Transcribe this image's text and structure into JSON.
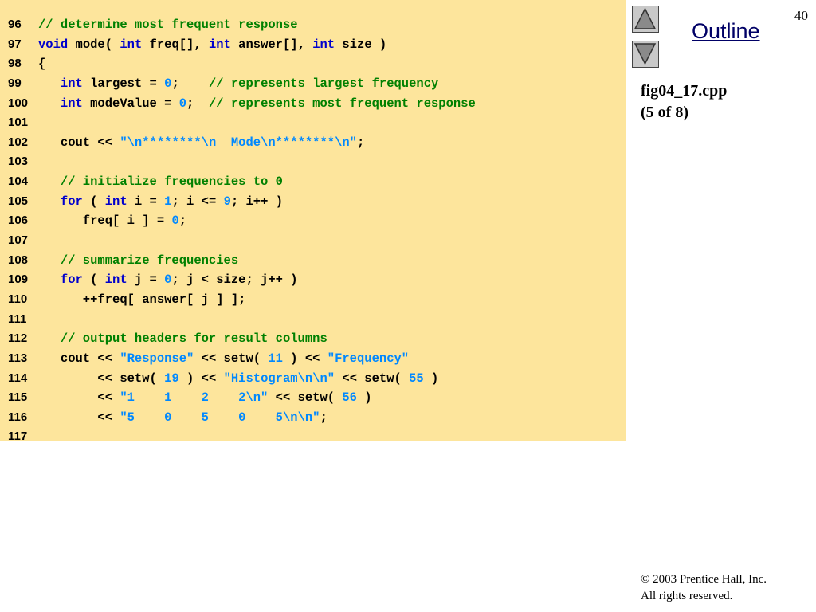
{
  "slide": {
    "number": "40"
  },
  "nav": {
    "up_icon": "triangle-up-icon",
    "down_icon": "triangle-down-icon",
    "outline_label": "Outline"
  },
  "fig": {
    "file": "fig04_17.cpp",
    "part": "(5 of 8)"
  },
  "footer": {
    "copyright": "© 2003 Prentice Hall, Inc.",
    "rights": "All rights reserved."
  },
  "colors": {
    "code_bg": "#fde59c",
    "comment": "#008000",
    "keyword": "#0000cc",
    "literal": "#0088ff"
  },
  "code_lines": [
    {
      "n": "96",
      "tokens": [
        [
          "c",
          "// determine most frequent response"
        ]
      ]
    },
    {
      "n": "97",
      "tokens": [
        [
          "k",
          "void"
        ],
        [
          "p",
          " mode( "
        ],
        [
          "k",
          "int"
        ],
        [
          "p",
          " freq[], "
        ],
        [
          "k",
          "int"
        ],
        [
          "p",
          " answer[], "
        ],
        [
          "k",
          "int"
        ],
        [
          "p",
          " size )"
        ]
      ]
    },
    {
      "n": "98",
      "tokens": [
        [
          "p",
          "{"
        ]
      ]
    },
    {
      "n": "99",
      "tokens": [
        [
          "p",
          "   "
        ],
        [
          "k",
          "int"
        ],
        [
          "p",
          " largest = "
        ],
        [
          "l",
          "0"
        ],
        [
          "p",
          ";    "
        ],
        [
          "c",
          "// represents largest frequency"
        ]
      ]
    },
    {
      "n": "100",
      "tokens": [
        [
          "p",
          "   "
        ],
        [
          "k",
          "int"
        ],
        [
          "p",
          " modeValue = "
        ],
        [
          "l",
          "0"
        ],
        [
          "p",
          ";  "
        ],
        [
          "c",
          "// represents most frequent response"
        ]
      ]
    },
    {
      "n": "101",
      "tokens": []
    },
    {
      "n": "102",
      "tokens": [
        [
          "p",
          "   cout << "
        ],
        [
          "l",
          "\"\\n********\\n  Mode\\n********\\n\""
        ],
        [
          "p",
          ";"
        ]
      ]
    },
    {
      "n": "103",
      "tokens": []
    },
    {
      "n": "104",
      "tokens": [
        [
          "p",
          "   "
        ],
        [
          "c",
          "// initialize frequencies to 0"
        ]
      ]
    },
    {
      "n": "105",
      "tokens": [
        [
          "p",
          "   "
        ],
        [
          "k",
          "for"
        ],
        [
          "p",
          " ( "
        ],
        [
          "k",
          "int"
        ],
        [
          "p",
          " i = "
        ],
        [
          "l",
          "1"
        ],
        [
          "p",
          "; i <= "
        ],
        [
          "l",
          "9"
        ],
        [
          "p",
          "; i++ )"
        ]
      ]
    },
    {
      "n": "106",
      "tokens": [
        [
          "p",
          "      freq[ i ] = "
        ],
        [
          "l",
          "0"
        ],
        [
          "p",
          ";"
        ]
      ]
    },
    {
      "n": "107",
      "tokens": []
    },
    {
      "n": "108",
      "tokens": [
        [
          "p",
          "   "
        ],
        [
          "c",
          "// summarize frequencies"
        ]
      ]
    },
    {
      "n": "109",
      "tokens": [
        [
          "p",
          "   "
        ],
        [
          "k",
          "for"
        ],
        [
          "p",
          " ( "
        ],
        [
          "k",
          "int"
        ],
        [
          "p",
          " j = "
        ],
        [
          "l",
          "0"
        ],
        [
          "p",
          "; j < size; j++ )"
        ]
      ]
    },
    {
      "n": "110",
      "tokens": [
        [
          "p",
          "      ++freq[ answer[ j ] ];"
        ]
      ]
    },
    {
      "n": "111",
      "tokens": []
    },
    {
      "n": "112",
      "tokens": [
        [
          "p",
          "   "
        ],
        [
          "c",
          "// output headers for result columns"
        ]
      ]
    },
    {
      "n": "113",
      "tokens": [
        [
          "p",
          "   cout << "
        ],
        [
          "l",
          "\"Response\""
        ],
        [
          "p",
          " << setw( "
        ],
        [
          "l",
          "11"
        ],
        [
          "p",
          " ) << "
        ],
        [
          "l",
          "\"Frequency\""
        ]
      ]
    },
    {
      "n": "114",
      "tokens": [
        [
          "p",
          "        << setw( "
        ],
        [
          "l",
          "19"
        ],
        [
          "p",
          " ) << "
        ],
        [
          "l",
          "\"Histogram\\n\\n\""
        ],
        [
          "p",
          " << setw( "
        ],
        [
          "l",
          "55"
        ],
        [
          "p",
          " )"
        ]
      ]
    },
    {
      "n": "115",
      "tokens": [
        [
          "p",
          "        << "
        ],
        [
          "l",
          "\"1    1    2    2\\n\""
        ],
        [
          "p",
          " << setw( "
        ],
        [
          "l",
          "56"
        ],
        [
          "p",
          " )"
        ]
      ]
    },
    {
      "n": "116",
      "tokens": [
        [
          "p",
          "        << "
        ],
        [
          "l",
          "\"5    0    5    0    5\\n\\n\""
        ],
        [
          "p",
          ";"
        ]
      ]
    },
    {
      "n": "117",
      "tokens": []
    }
  ]
}
